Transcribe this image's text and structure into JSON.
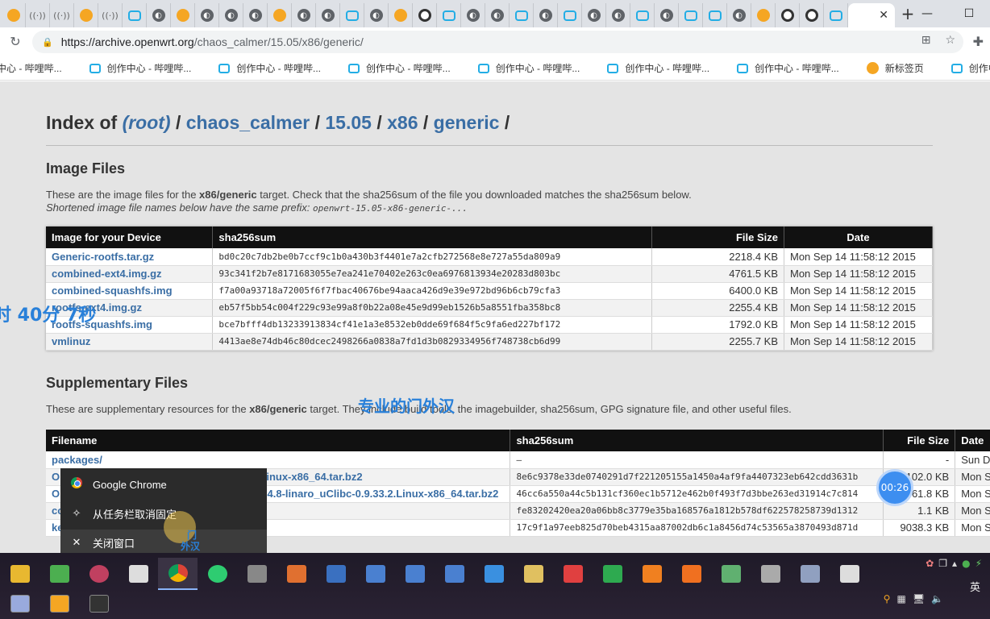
{
  "browser": {
    "tab_icons": [
      "orange",
      "radio",
      "radio",
      "orange",
      "radio",
      "bili",
      "gray",
      "orange",
      "gray",
      "gray",
      "gray",
      "orange",
      "gray",
      "gray",
      "bili",
      "gray",
      "orange",
      "eye",
      "bili",
      "gray",
      "gray",
      "bili",
      "gray",
      "bili",
      "gray",
      "gray",
      "bili",
      "gray",
      "bili",
      "bili",
      "gray",
      "orange",
      "eye",
      "eye",
      "bili"
    ],
    "active_tab_close": "✕",
    "new_tab": "+",
    "win_min": "—",
    "win_max": "☐",
    "url_host": "https://archive.openwrt.org",
    "url_path": "/chaos_calmer/15.05/x86/generic/"
  },
  "bookmarks": [
    {
      "label": "中心 - 哔哩哔...",
      "icon": "bili"
    },
    {
      "label": "创作中心 - 哔哩哔...",
      "icon": "bili"
    },
    {
      "label": "创作中心 - 哔哩哔...",
      "icon": "bili"
    },
    {
      "label": "创作中心 - 哔哩哔...",
      "icon": "bili"
    },
    {
      "label": "创作中心 - 哔哩哔...",
      "icon": "bili"
    },
    {
      "label": "创作中心 - 哔哩哔...",
      "icon": "bili"
    },
    {
      "label": "创作中心 - 哔哩哔...",
      "icon": "bili"
    },
    {
      "label": "新标签页",
      "icon": "orange"
    },
    {
      "label": "创作中心 - 哔哩哔...",
      "icon": "bili"
    }
  ],
  "page": {
    "index_of": "Index of",
    "crumb_root": "(root)",
    "crumb_sep": "/",
    "crumbs": [
      "chaos_calmer",
      "15.05",
      "x86",
      "generic"
    ],
    "image_heading": "Image Files",
    "image_desc_pre": "These are the image files for the ",
    "target": "x86/generic",
    "image_desc_post": " target. Check that the sha256sum of the file you downloaded matches the sha256sum below.",
    "image_desc2": "Shortened image file names below have the same prefix: ",
    "prefix": "openwrt-15.05-x86-generic-...",
    "image_table": {
      "headers": [
        "Image for your Device",
        "sha256sum",
        "File Size",
        "Date"
      ],
      "rows": [
        [
          "Generic-rootfs.tar.gz",
          "bd0c20c7db2be0b7ccf9c1b0a430b3f4401e7a2cfb272568e8e727a55da809a9",
          "2218.4 KB",
          "Mon Sep 14 11:58:12 2015"
        ],
        [
          "combined-ext4.img.gz",
          "93c341f2b7e8171683055e7ea241e70402e263c0ea6976813934e20283d803bc",
          "4761.5 KB",
          "Mon Sep 14 11:58:12 2015"
        ],
        [
          "combined-squashfs.img",
          "f7a00a93718a72005f6f7fbac40676be94aaca426d9e39e972bd96b6cb79cfa3",
          "6400.0 KB",
          "Mon Sep 14 11:58:12 2015"
        ],
        [
          "rootfs-ext4.img.gz",
          "eb57f5bb54c004f229c93e99a8f0b22a08e45e9d99eb1526b5a8551fba358bc8",
          "2255.4 KB",
          "Mon Sep 14 11:58:12 2015"
        ],
        [
          "rootfs-squashfs.img",
          "bce7bfff4db13233913834cf41e1a3e8532eb0dde69f684f5c9fa6ed227bf172",
          "1792.0 KB",
          "Mon Sep 14 11:58:12 2015"
        ],
        [
          "vmlinuz",
          "4413ae8e74db46c80dcec2498266a0838a7fd1d3b0829334956f748738cb6d99",
          "2255.7 KB",
          "Mon Sep 14 11:58:12 2015"
        ]
      ]
    },
    "supp_heading": "Supplementary Files",
    "supp_desc_pre": "These are supplementary resources for the ",
    "supp_desc_post": " target. They include build tools, the imagebuilder, sha256sum, GPG signature file, and other useful files.",
    "supp_table": {
      "headers": [
        "Filename",
        "sha256sum",
        "File Size",
        "Date"
      ],
      "rows": [
        [
          "packages/",
          "–",
          "-",
          "Sun D"
        ],
        [
          "OpenWrt-ImageBuilder-15.05-x86-generic.Linux-x86_64.tar.bz2",
          "8e6c9378e33de0740291d7f221205155a1450a4af9fa4407323eb642cdd3631b",
          "102.0 KB",
          "Mon S"
        ],
        [
          "OpenWrt-Toolchain-15.05-x86-for-i386_gcc-4.8-linaro_uClibc-0.9.33.2.Linux-x86_64.tar.bz2",
          "46cc6a550a44c5b131cf360ec1b5712e462b0f493f7d3bbe263ed31914c7c814",
          "61.8 KB",
          "Mon S"
        ],
        [
          "config.diff",
          "fe83202420ea20a06bb8c3779e35ba168576a1812b578df622578258739d1312",
          "1.1 KB",
          "Mon S"
        ],
        [
          "kernel-debug.tar.bz2",
          "17c9f1a97eeb825d70beb4315aa87002db6c1a8456d74c53565a3870493d871d",
          "9038.3 KB",
          "Mon S"
        ]
      ]
    }
  },
  "overlays": {
    "timer_text": "时 40分 7秒",
    "caption": "专业的门外汉",
    "timer_bubble": "00:26",
    "small_line1": "门",
    "small_line2": "外汉"
  },
  "context_menu": {
    "items": [
      {
        "label": "Google Chrome",
        "icon": "chrome-icon"
      },
      {
        "label": "从任务栏取消固定",
        "icon": "unpin-icon"
      },
      {
        "label": "关闭窗口",
        "icon": "close-icon"
      }
    ]
  },
  "taskbar": {
    "ime": "英",
    "icon_colors": [
      "#e8b830",
      "#4caf50",
      "#c04060",
      "#ddd",
      "#4285f4",
      "#2ecc71",
      "#888",
      "#e07030",
      "#3a70c0",
      "#4a80d0",
      "#4a80d0",
      "#4a80d0",
      "#3a90e0",
      "#e0c060",
      "#e04040",
      "#2eaa50",
      "#f08020",
      "#f07020",
      "#60b070",
      "#aaa",
      "#90a0c0",
      "#ddd"
    ],
    "row2_colors": [
      "#9ad",
      "#f5a623",
      "#333"
    ]
  }
}
